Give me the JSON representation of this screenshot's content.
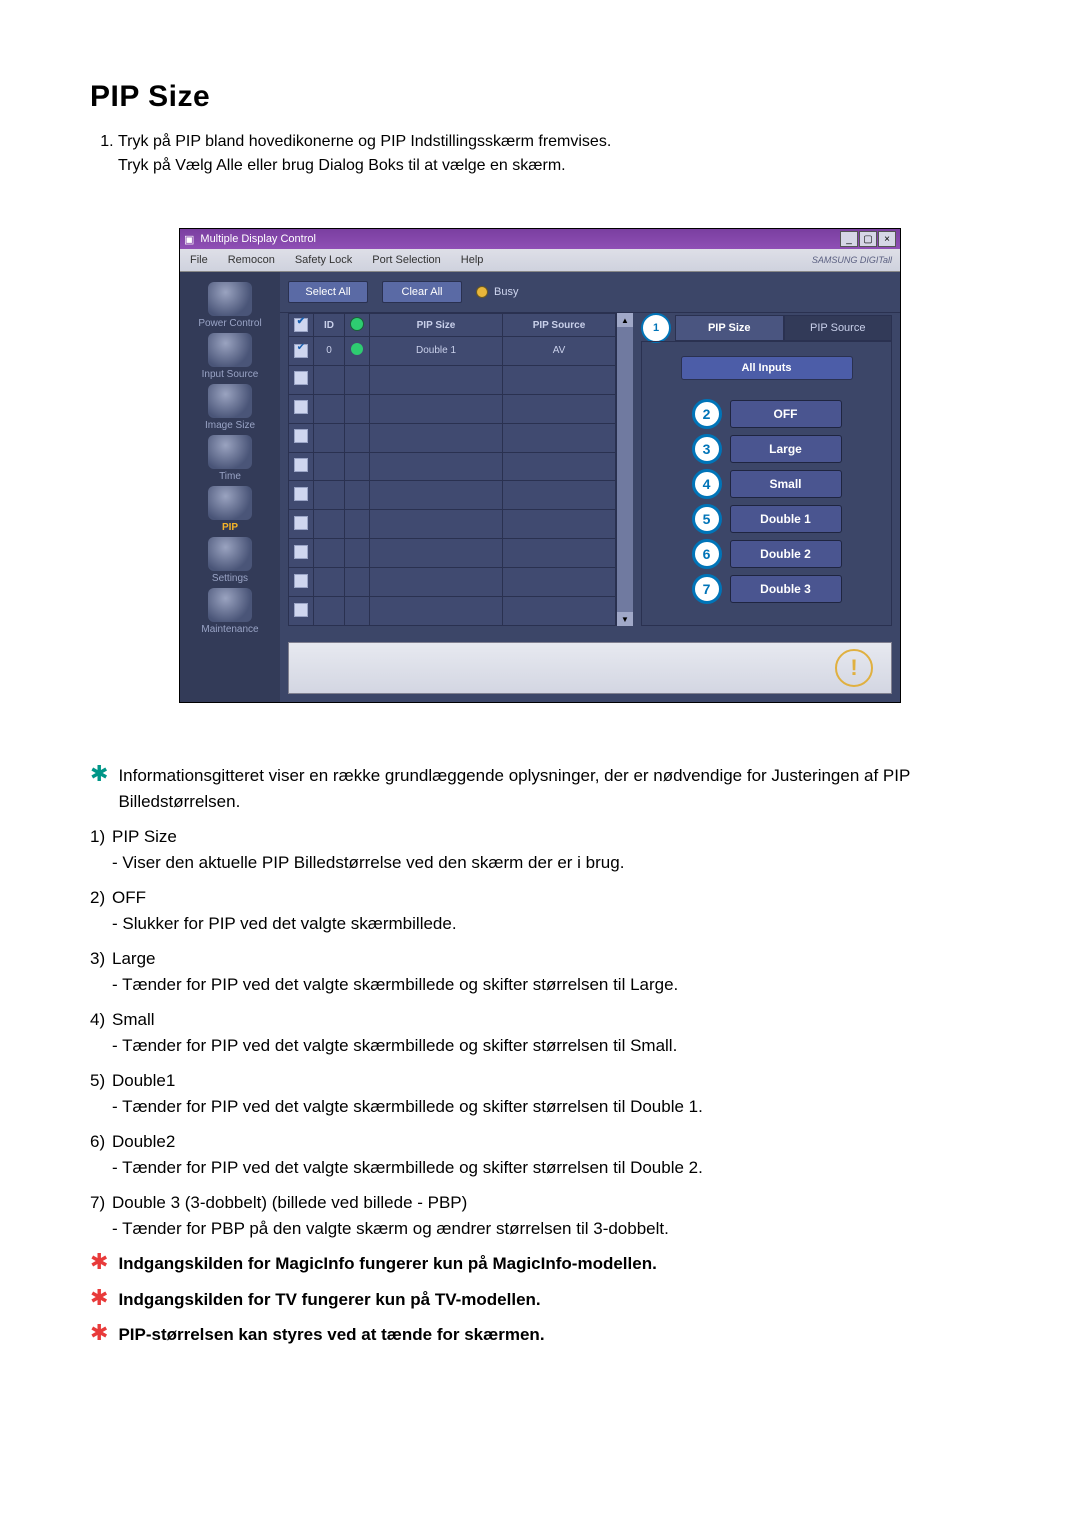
{
  "title": "PIP Size",
  "intro": [
    "Tryk på PIP bland hovedikonerne og PIP Indstillingsskærm fremvises.",
    "Tryk på Vælg Alle eller brug Dialog Boks til at vælge en skærm."
  ],
  "app": {
    "window_title": "Multiple Display Control",
    "brand": "SAMSUNG DIGITall",
    "menu": [
      "File",
      "Remocon",
      "Safety Lock",
      "Port Selection",
      "Help"
    ],
    "sidebar": [
      {
        "label": "Power Control",
        "icon": "power-icon"
      },
      {
        "label": "Input Source",
        "icon": "source-icon"
      },
      {
        "label": "Image Size",
        "icon": "imagesize-icon"
      },
      {
        "label": "Time",
        "icon": "time-icon"
      },
      {
        "label": "PIP",
        "icon": "pip-icon",
        "active": true
      },
      {
        "label": "Settings",
        "icon": "settings-icon"
      },
      {
        "label": "Maintenance",
        "icon": "maintenance-icon"
      }
    ],
    "toolbar": {
      "select_all": "Select All",
      "clear_all": "Clear All",
      "busy": "Busy"
    },
    "grid": {
      "headers": {
        "chk": "",
        "id": "ID",
        "status": "",
        "pip_size": "PIP Size",
        "pip_source": "PIP Source"
      },
      "row": {
        "id": "0",
        "pip_size": "Double 1",
        "pip_source": "AV",
        "checked": true
      },
      "empty_rows": 9
    },
    "right": {
      "tabs": {
        "pip_size": "PIP Size",
        "pip_source": "PIP Source"
      },
      "tab_marker_num": "1",
      "all_inputs": "All Inputs",
      "options": [
        {
          "n": "2",
          "label": "OFF"
        },
        {
          "n": "3",
          "label": "Large"
        },
        {
          "n": "4",
          "label": "Small"
        },
        {
          "n": "5",
          "label": "Double 1"
        },
        {
          "n": "6",
          "label": "Double 2"
        },
        {
          "n": "7",
          "label": "Double 3"
        }
      ]
    }
  },
  "info_note": "Informationsgitteret viser en række grundlæggende oplysninger, der er nødvendige for Justeringen af PIP Billedstørrelsen.",
  "items": [
    {
      "n": "1)",
      "t": "PIP Size",
      "d": "- Viser den aktuelle PIP Billedstørrelse ved den skærm der er i brug."
    },
    {
      "n": "2)",
      "t": "OFF",
      "d": "- Slukker for PIP ved det valgte skærmbillede."
    },
    {
      "n": "3)",
      "t": "Large",
      "d": "- Tænder for PIP ved det valgte skærmbillede og skifter størrelsen til Large."
    },
    {
      "n": "4)",
      "t": "Small",
      "d": "- Tænder for PIP ved det valgte skærmbillede og skifter størrelsen til Small."
    },
    {
      "n": "5)",
      "t": "Double1",
      "d": "- Tænder for PIP ved det valgte skærmbillede og skifter størrelsen til Double 1."
    },
    {
      "n": "6)",
      "t": "Double2",
      "d": "- Tænder for PIP ved det valgte skærmbillede og skifter størrelsen til Double 2."
    },
    {
      "n": "7)",
      "t": "Double 3 (3-dobbelt) (billede ved billede - PBP)",
      "d": "- Tænder for PBP på den valgte skærm og ændrer størrelsen til 3-dobbelt."
    }
  ],
  "red_notes": [
    "Indgangskilden for MagicInfo fungerer kun på MagicInfo-modellen.",
    "Indgangskilden for TV fungerer kun på TV-modellen.",
    "PIP-størrelsen kan styres ved at tænde for skærmen."
  ]
}
